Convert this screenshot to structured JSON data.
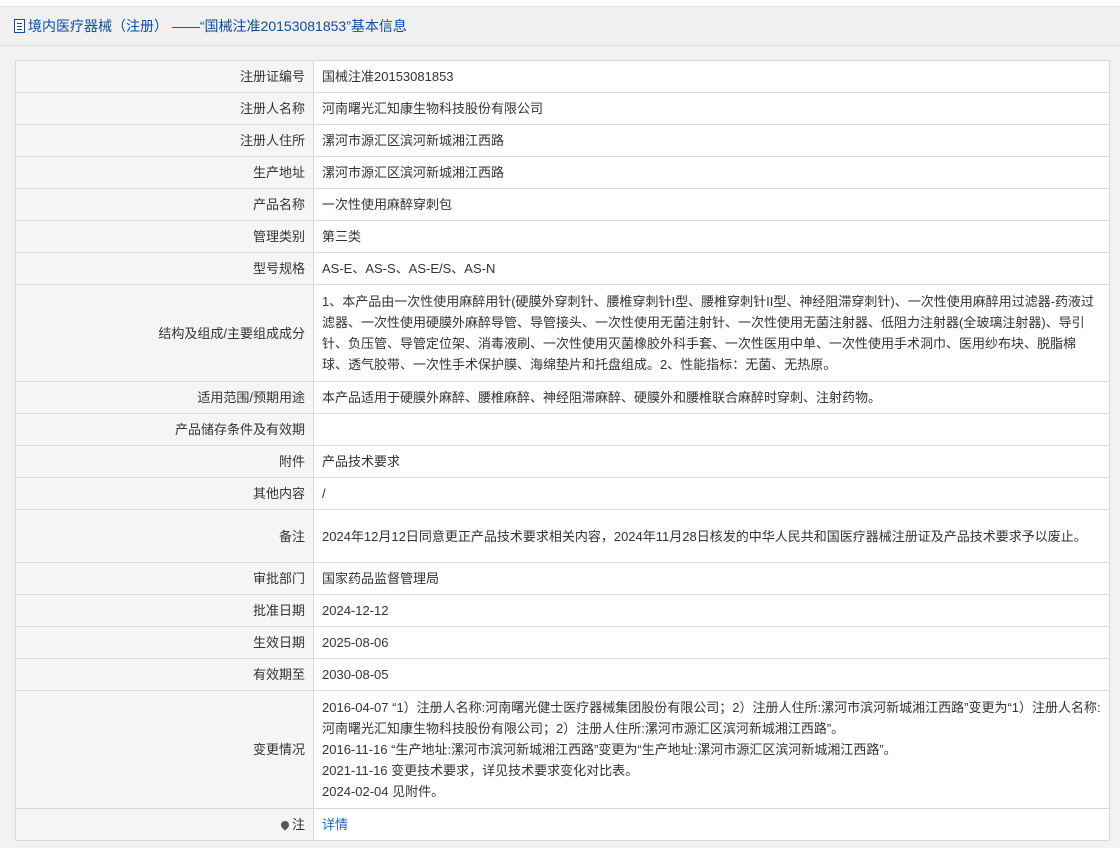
{
  "header": {
    "title": "境内医疗器械（注册） ——“国械注准20153081853”基本信息"
  },
  "rows": [
    {
      "label": "注册证编号",
      "value": "国械注准20153081853"
    },
    {
      "label": "注册人名称",
      "value": "河南曙光汇知康生物科技股份有限公司"
    },
    {
      "label": "注册人住所",
      "value": "漯河市源汇区滨河新城湘江西路"
    },
    {
      "label": "生产地址",
      "value": "漯河市源汇区滨河新城湘江西路"
    },
    {
      "label": "产品名称",
      "value": "一次性使用麻醉穿刺包"
    },
    {
      "label": "管理类别",
      "value": "第三类"
    },
    {
      "label": "型号规格",
      "value": "AS-E、AS-S、AS-E/S、AS-N"
    },
    {
      "label": "结构及组成/主要组成成分",
      "value": "1、本产品由一次性使用麻醉用针(硬膜外穿刺针、腰椎穿刺针I型、腰椎穿刺针II型、神经阻滞穿刺针)、一次性使用麻醉用过滤器-药液过滤器、一次性使用硬膜外麻醉导管、导管接头、一次性使用无菌注射针、一次性使用无菌注射器、低阻力注射器(全玻璃注射器)、导引针、负压管、导管定位架、消毒液刷、一次性使用灭菌橡胶外科手套、一次性医用中单、一次性使用手术洞巾、医用纱布块、脱脂棉球、透气胶带、一次性手术保护膜、海绵垫片和托盘组成。2、性能指标：无菌、无热原。"
    },
    {
      "label": "适用范围/预期用途",
      "value": "本产品适用于硬膜外麻醉、腰椎麻醉、神经阻滞麻醉、硬膜外和腰椎联合麻醉时穿刺、注射药物。"
    },
    {
      "label": "产品储存条件及有效期",
      "value": ""
    },
    {
      "label": "附件",
      "value": "产品技术要求"
    },
    {
      "label": "其他内容",
      "value": "/"
    },
    {
      "label": "备注",
      "value": "2024年12月12日同意更正产品技术要求相关内容，2024年11月28日核发的中华人民共和国医疗器械注册证及产品技术要求予以废止。"
    },
    {
      "label": "审批部门",
      "value": "国家药品监督管理局"
    },
    {
      "label": "批准日期",
      "value": "2024-12-12"
    },
    {
      "label": "生效日期",
      "value": "2025-08-06"
    },
    {
      "label": "有效期至",
      "value": "2030-08-05"
    }
  ],
  "changes": {
    "label": "变更情况",
    "lines": [
      "2016-04-07 “1）注册人名称:河南曙光健士医疗器械集团股份有限公司；2）注册人住所:漯河市滨河新城湘江西路”变更为“1）注册人名称:河南曙光汇知康生物科技股份有限公司；2）注册人住所:漯河市源汇区滨河新城湘江西路”。",
      "2016-11-16 “生产地址:漯河市滨河新城湘江西路”变更为“生产地址:漯河市源汇区滨河新城湘江西路”。",
      "2021-11-16 变更技术要求，详见技术要求变化对比表。",
      "2024-02-04 见附件。"
    ]
  },
  "note": {
    "label": "注",
    "link": "详情",
    "icon": "pin-icon"
  }
}
